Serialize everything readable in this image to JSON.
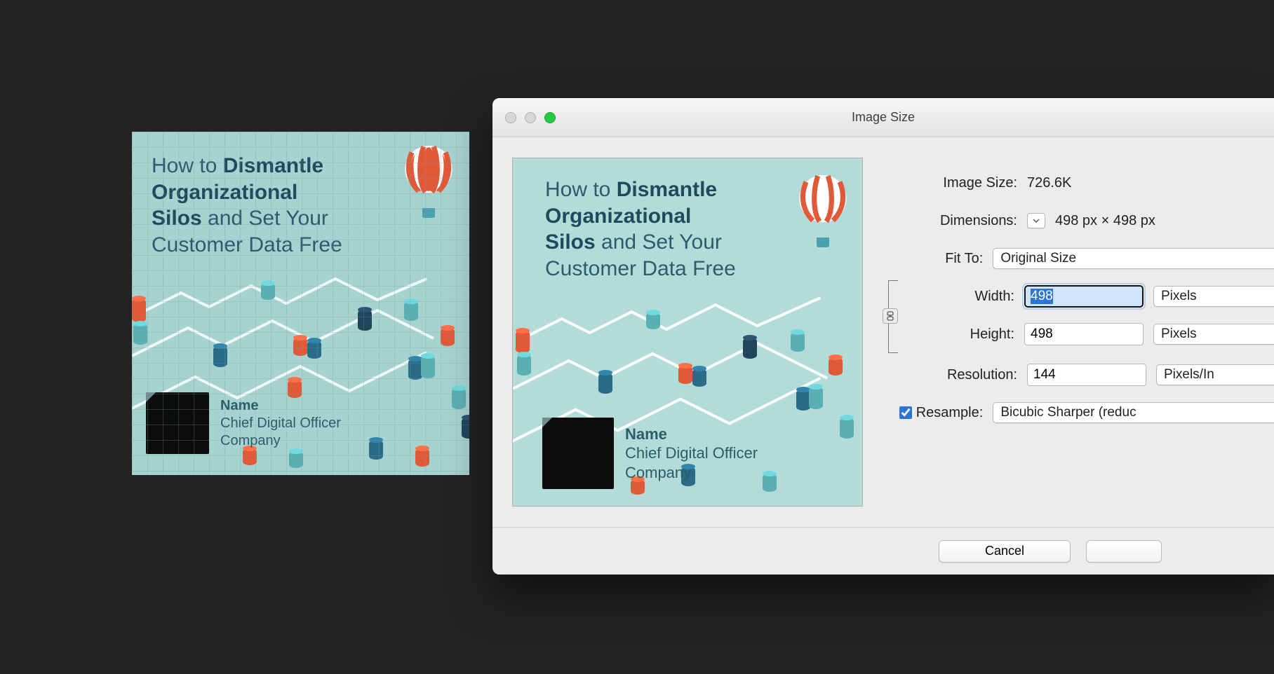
{
  "illustration": {
    "title_prefix": "How to ",
    "title_bold": "Dismantle Organizational Silos",
    "title_suffix": " and Set Your Customer Data Free",
    "name_label": "Name",
    "role": "Chief Digital Officer",
    "company": "Company"
  },
  "dialog": {
    "title": "Image Size",
    "image_size_label": "Image Size:",
    "image_size_value": "726.6K",
    "dimensions_label": "Dimensions:",
    "dimensions_value": "498 px  ×  498 px",
    "fit_to_label": "Fit To:",
    "fit_to_value": "Original Size",
    "width_label": "Width:",
    "width_value": "498",
    "height_label": "Height:",
    "height_value": "498",
    "unit_pixels": "Pixels",
    "resolution_label": "Resolution:",
    "resolution_value": "144",
    "resolution_unit": "Pixels/In",
    "resample_label": "Resample:",
    "resample_value": "Bicubic Sharper (reduc",
    "cancel": "Cancel"
  }
}
